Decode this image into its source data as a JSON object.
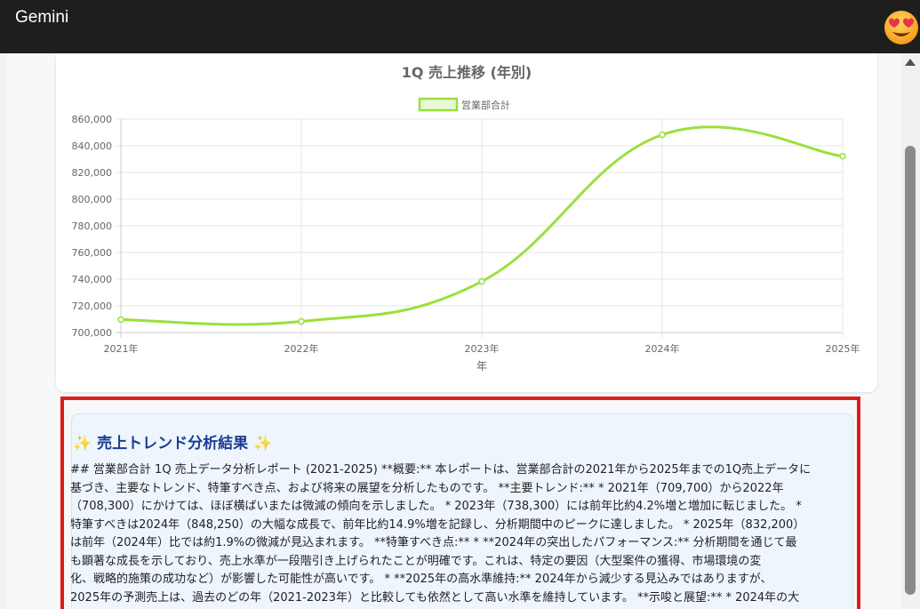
{
  "app": {
    "title": "Gemini"
  },
  "chart_data": {
    "type": "line",
    "title": "1Q 売上推移 (年別)",
    "xlabel": "年",
    "ylabel": "",
    "categories": [
      "2021年",
      "2022年",
      "2023年",
      "2024年",
      "2025年"
    ],
    "series": [
      {
        "name": "営業部合計",
        "values": [
          709700,
          708300,
          738300,
          848250,
          832200
        ]
      }
    ],
    "ylim": [
      700000,
      860000
    ],
    "yticks": [
      "700,000",
      "720,000",
      "740,000",
      "760,000",
      "780,000",
      "800,000",
      "820,000",
      "840,000",
      "860,000"
    ],
    "grid": true,
    "legend": "top-center",
    "colors": {
      "line": "#9ae03c",
      "legend_fill": "#e8f7d6"
    }
  },
  "analysis": {
    "title": "売上トレンド分析結果",
    "sparkle": "✨",
    "lines": [
      "## 営業部合計 1Q 売上データ分析レポート (2021-2025) **概要:** 本レポートは、営業部合計の2021年から2025年までの1Q売上データに",
      "基づき、主要なトレンド、特筆すべき点、および将来の展望を分析したものです。 **主要トレンド:** * 2021年（709,700）から2022年",
      "（708,300）にかけては、ほぼ横ばいまたは微減の傾向を示しました。 * 2023年（738,300）には前年比約4.2%増と増加に転じました。 *",
      "特筆すべきは2024年（848,250）の大幅な成長で、前年比約14.9%増を記録し、分析期間中のピークに達しました。 * 2025年（832,200）",
      "は前年（2024年）比では約1.9%の微減が見込まれます。 **特筆すべき点:** * **2024年の突出したパフォーマンス:** 分析期間を通じて最",
      "も顕著な成長を示しており、売上水準が一段階引き上げられたことが明確です。これは、特定の要因（大型案件の獲得、市場環境の変",
      "化、戦略的施策の成功など）が影響した可能性が高いです。 * **2025年の高水準維持:** 2024年から減少する見込みではありますが、",
      "2025年の予測売上は、過去のどの年（2021-2023年）と比較しても依然として高い水準を維持しています。 **示唆と展望:** * 2024年の大"
    ]
  }
}
